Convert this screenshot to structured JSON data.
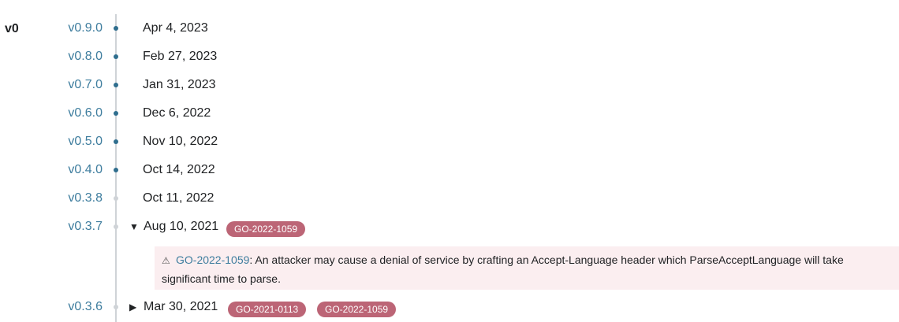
{
  "major_version": "v0",
  "versions": [
    {
      "version": "v0.9.0",
      "date": "Apr 4, 2023"
    },
    {
      "version": "v0.8.0",
      "date": "Feb 27, 2023"
    },
    {
      "version": "v0.7.0",
      "date": "Jan 31, 2023"
    },
    {
      "version": "v0.6.0",
      "date": "Dec 6, 2022"
    },
    {
      "version": "v0.5.0",
      "date": "Nov 10, 2022"
    },
    {
      "version": "v0.4.0",
      "date": "Oct 14, 2022"
    },
    {
      "version": "v0.3.8",
      "date": "Oct 11, 2022"
    },
    {
      "version": "v0.3.7",
      "date": "Aug 10, 2021",
      "badges": [
        "GO-2022-1059"
      ],
      "expanded": true
    },
    {
      "version": "v0.3.6",
      "date": "Mar 30, 2021",
      "badges": [
        "GO-2021-0113",
        "GO-2022-1059"
      ],
      "expanded": false
    }
  ],
  "vuln_detail": {
    "id": "GO-2022-1059",
    "text": ": An attacker may cause a denial of service by crafting an Accept-Language header which ParseAcceptLanguage will take significant time to parse."
  },
  "toggles": {
    "expanded": "▼",
    "collapsed": "▶"
  },
  "icons": {
    "warning": "warning-icon"
  },
  "colors": {
    "link": "#3e7d9e",
    "dot": "#2f6e8e",
    "badge": "#bc6576",
    "vuln_bg": "#fbeef0"
  }
}
